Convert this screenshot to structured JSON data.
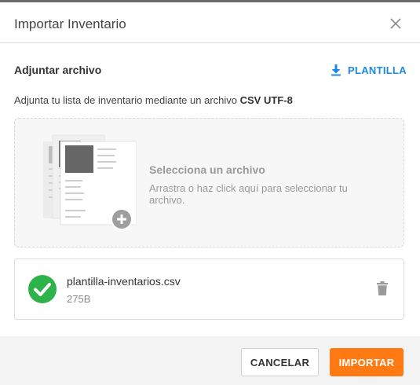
{
  "dialog": {
    "title": "Importar Inventario",
    "close_icon": "close-icon"
  },
  "attach": {
    "section_title": "Adjuntar archivo",
    "template_label": "PLANTILLA",
    "template_icon": "download-icon",
    "description_prefix": "Adjunta tu lista de inventario mediante un archivo ",
    "description_format": "CSV UTF-8"
  },
  "dropzone": {
    "title": "Selecciona un archivo",
    "subtitle": "Arrastra o haz click aquí para seleccionar tu archivo.",
    "icon": "documents-add-icon"
  },
  "file": {
    "name": "plantilla-inventarios.csv",
    "size": "275B",
    "status_icon": "check-circle-icon",
    "delete_icon": "trash-icon"
  },
  "footer": {
    "cancel_label": "CANCELAR",
    "import_label": "IMPORTAR"
  },
  "colors": {
    "accent_link": "#1e88e5",
    "primary_button": "#ff7a12",
    "success": "#2eb24a"
  }
}
